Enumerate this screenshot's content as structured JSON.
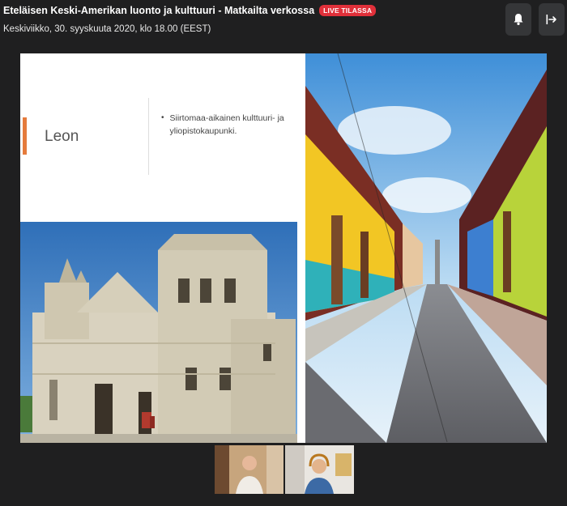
{
  "header": {
    "title": "Eteläisen Keski-Amerikan luonto ja kulttuuri - Matkailta verkossa",
    "live_badge": "LIVE TILASSA",
    "subtitle": "Keskiviikko, 30. syyskuuta 2020, klo 18.00 (EEST)",
    "notification_icon": "bell-icon",
    "leave_icon": "exit-icon"
  },
  "slide": {
    "heading": "Leon",
    "bullets": [
      "Siirtomaa-aikainen kulttuuri- ja yliopistokaupunki."
    ],
    "accent_color": "#e57b3c",
    "photos": [
      "cathedral-photo",
      "colonial-street-photo"
    ]
  },
  "participants": [
    {
      "name_icon": "participant-video-1"
    },
    {
      "name_icon": "participant-video-2"
    }
  ],
  "colors": {
    "background": "#1f1f20",
    "live": "#e0303a",
    "button": "#353638"
  }
}
